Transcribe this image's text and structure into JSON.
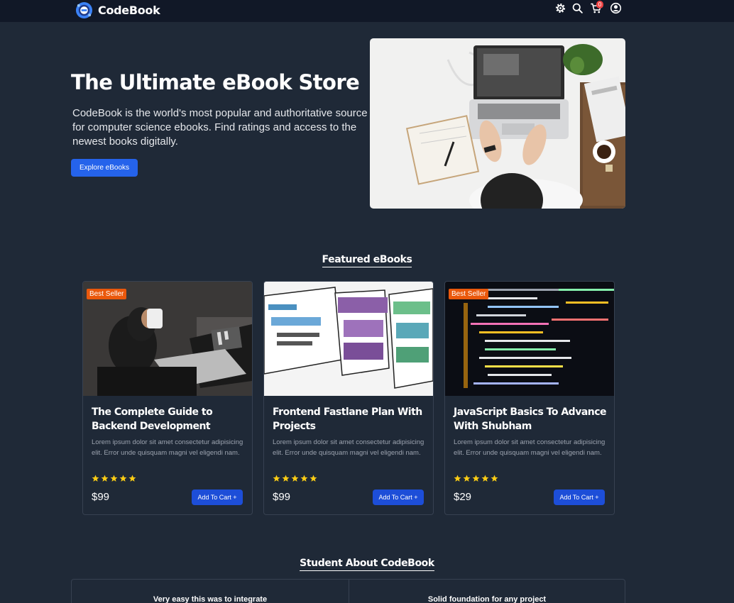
{
  "header": {
    "brand": "CodeBook",
    "cart_count": "0",
    "icons": [
      "gear-icon",
      "search-icon",
      "cart-icon",
      "user-icon"
    ]
  },
  "hero": {
    "title": "The Ultimate eBook Store",
    "description": "CodeBook is the world's most popular and authoritative source for computer science ebooks. Find ratings and access to the newest books digitally.",
    "button": "Explore eBooks"
  },
  "featured": {
    "title": "Featured eBooks",
    "products": [
      {
        "badge": "Best Seller",
        "title": "The Complete Guide to Backend Development",
        "description": "Lorem ipsum dolor sit amet consectetur adipisicing elit. Error unde quisquam magni vel eligendi nam.",
        "rating": 5,
        "price": "$99",
        "button": "Add To Cart +"
      },
      {
        "badge": "",
        "title": "Frontend Fastlane Plan With Projects",
        "description": "Lorem ipsum dolor sit amet consectetur adipisicing elit. Error unde quisquam magni vel eligendi nam.",
        "rating": 5,
        "price": "$99",
        "button": "Add To Cart +"
      },
      {
        "badge": "Best Seller",
        "title": "JavaScript Basics To Advance With Shubham",
        "description": "Lorem ipsum dolor sit amet consectetur adipisicing elit. Error unde quisquam magni vel eligendi nam.",
        "rating": 5,
        "price": "$29",
        "button": "Add To Cart +"
      }
    ]
  },
  "testimonials": {
    "title": "Student About CodeBook",
    "items": [
      {
        "heading": "Very easy this was to integrate"
      },
      {
        "heading": "Solid foundation for any project"
      }
    ]
  },
  "colors": {
    "background": "#1f2937",
    "header": "#111827",
    "primary_button": "#2563eb",
    "badge": "#ea580c",
    "star": "#facc15"
  }
}
